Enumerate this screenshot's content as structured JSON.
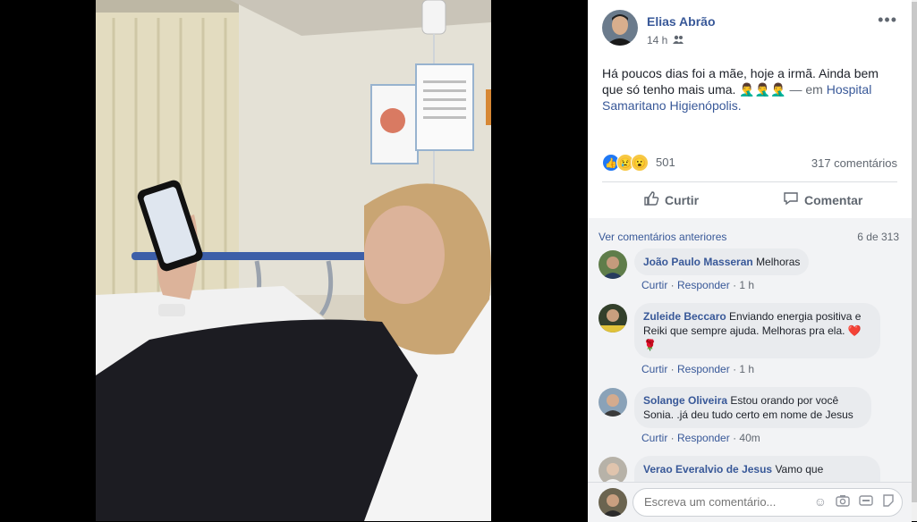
{
  "post": {
    "author": "Elias Abrão",
    "time": "14 h",
    "audience_icon": "friends-icon",
    "text_main": "Há poucos dias foi a mãe, hoje a irmã. Ainda bem que só tenho mais uma. 🤦‍♂️🤦‍♂️🤦‍♂️",
    "text_em": " — em ",
    "text_place": "Hospital Samaritano Higienópolis."
  },
  "reactions": {
    "icons": [
      "like-icon",
      "sad-icon",
      "wow-icon"
    ],
    "count": "501",
    "comments_count": "317 comentários"
  },
  "actions": {
    "like_label": "Curtir",
    "comment_label": "Comentar"
  },
  "comments": {
    "previous_label": "Ver comentários anteriores",
    "pager": "6 de 313",
    "items": [
      {
        "name": "João Paulo Masseran",
        "text": "Melhoras",
        "like": "Curtir",
        "reply": "Responder",
        "time": "1 h"
      },
      {
        "name": "Zuleide Beccaro",
        "text": "Enviando energia positiva e Reiki que sempre ajuda. Melhoras pra ela. ❤️🌹",
        "like": "Curtir",
        "reply": "Responder",
        "time": "1 h"
      },
      {
        "name": "Solange Oliveira",
        "text": "Estou orando por você Sonia. .já deu tudo certo em nome de Jesus",
        "like": "Curtir",
        "reply": "Responder",
        "time": "40m"
      },
      {
        "name": "Verao Everalvio de Jesus",
        "text": "Vamo que"
      }
    ]
  },
  "composer": {
    "placeholder": "Escreva um comentário...",
    "icons": [
      "emoji-icon",
      "camera-icon",
      "gif-icon",
      "sticker-icon"
    ]
  },
  "colors": {
    "link": "#385898",
    "bubble": "#e9ebee",
    "panel_bg": "#ffffff",
    "comments_bg": "#f2f3f5"
  }
}
